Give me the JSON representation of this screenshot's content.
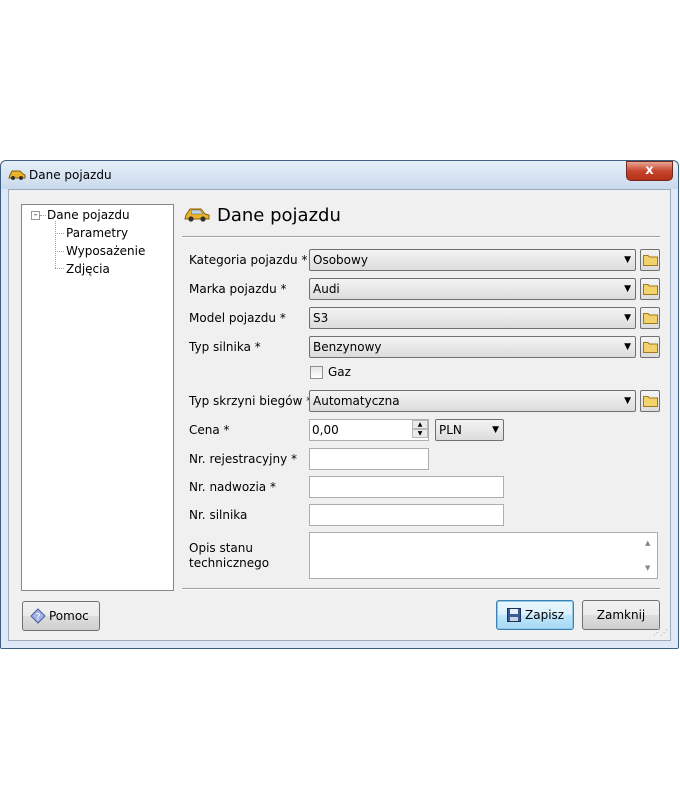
{
  "window": {
    "title": "Dane pojazdu",
    "close_label": "x"
  },
  "tree": {
    "root_label": "Dane pojazdu",
    "toggle": "-",
    "children": [
      "Parametry",
      "Wyposażenie",
      "Zdjęcia"
    ]
  },
  "header": {
    "title": "Dane pojazdu"
  },
  "form": {
    "category": {
      "label": "Kategoria pojazdu *",
      "value": "Osobowy"
    },
    "brand": {
      "label": "Marka pojazdu *",
      "value": "Audi"
    },
    "model": {
      "label": "Model pojazdu *",
      "value": "S3"
    },
    "engine_type": {
      "label": "Typ silnika *",
      "value": "Benzynowy"
    },
    "gas": {
      "label": "Gaz",
      "checked": false
    },
    "gearbox": {
      "label": "Typ skrzyni biegów *",
      "value": "Automatyczna"
    },
    "price": {
      "label": "Cena *",
      "value": "0,00",
      "currency": "PLN"
    },
    "registration": {
      "label": "Nr. rejestracyjny *",
      "value": ""
    },
    "vin": {
      "label": "Nr. nadwozia *",
      "value": ""
    },
    "engine_number": {
      "label": "Nr. silnika",
      "value": ""
    },
    "condition": {
      "label_line1": "Opis stanu",
      "label_line2": "technicznego",
      "value": ""
    }
  },
  "buttons": {
    "help": "Pomoc",
    "save": "Zapisz",
    "close": "Zamknij"
  },
  "glyphs": {
    "dropdown_arrow": "▼",
    "spin_up": "▲",
    "spin_down": "▼",
    "scroll_up": "▲",
    "scroll_down": "▼"
  }
}
